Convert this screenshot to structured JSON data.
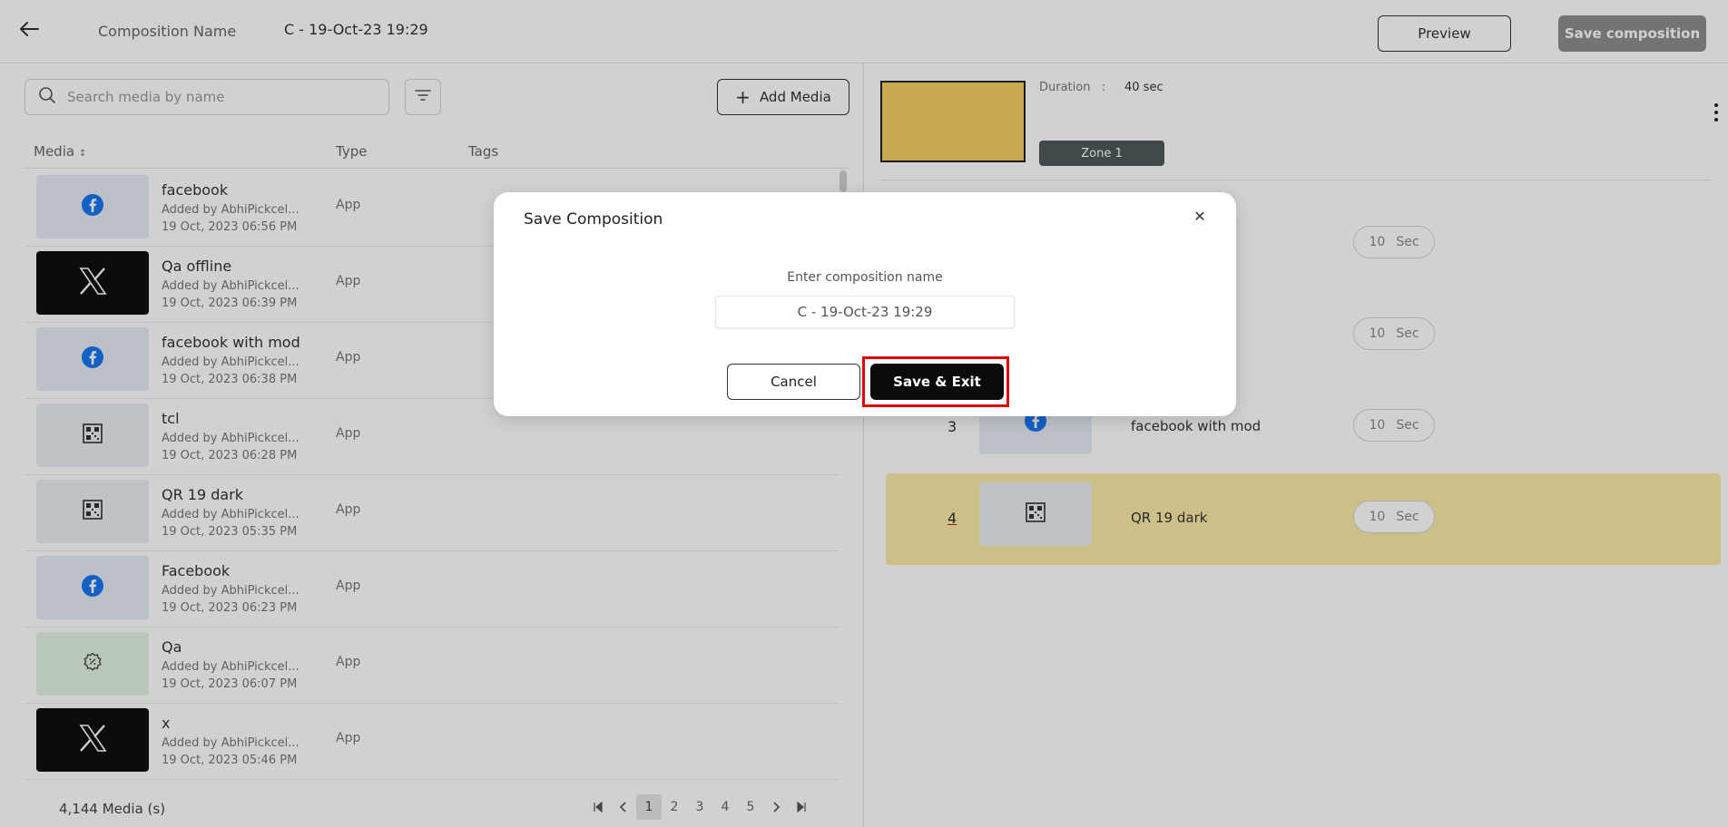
{
  "header": {
    "composition_label": "Composition Name",
    "composition_value": "C - 19-Oct-23 19:29",
    "preview_label": "Preview",
    "save_composition_label": "Save composition"
  },
  "library": {
    "search_placeholder": "Search media by name",
    "add_media_label": "Add Media",
    "columns": {
      "media": "Media",
      "type": "Type",
      "tags": "Tags"
    },
    "items": [
      {
        "name": "facebook",
        "added_by": "Added by AbhiPickcel...",
        "date": "19 Oct, 2023 06:56 PM",
        "type": "App",
        "icon": "facebook-icon"
      },
      {
        "name": "Qa offline",
        "added_by": "Added by AbhiPickcel...",
        "date": "19 Oct, 2023 06:39 PM",
        "type": "App",
        "icon": "x-logo-icon"
      },
      {
        "name": "facebook with mod",
        "added_by": "Added by AbhiPickcel...",
        "date": "19 Oct, 2023 06:38 PM",
        "type": "App",
        "icon": "facebook-icon"
      },
      {
        "name": "tcl",
        "added_by": "Added by AbhiPickcel...",
        "date": "19 Oct, 2023 06:28 PM",
        "type": "App",
        "icon": "qr-code-icon"
      },
      {
        "name": "QR 19 dark",
        "added_by": "Added by AbhiPickcel...",
        "date": "19 Oct, 2023 05:35 PM",
        "type": "App",
        "icon": "qr-code-icon"
      },
      {
        "name": "Facebook",
        "added_by": "Added by AbhiPickcel...",
        "date": "19 Oct, 2023 06:23 PM",
        "type": "App",
        "icon": "facebook-icon"
      },
      {
        "name": "Qa",
        "added_by": "Added by AbhiPickcel...",
        "date": "19 Oct, 2023 06:07 PM",
        "type": "App",
        "icon": "badge-icon"
      },
      {
        "name": "x",
        "added_by": "Added by AbhiPickcel...",
        "date": "19 Oct, 2023 05:46 PM",
        "type": "App",
        "icon": "x-logo-icon"
      }
    ],
    "count": "4,144 Media (s)",
    "pages": [
      "1",
      "2",
      "3",
      "4",
      "5"
    ],
    "current_page": "1"
  },
  "zone": {
    "duration_label": "Duration",
    "duration_separator": ":",
    "duration_value": "40 sec",
    "zone_label": "Zone 1",
    "preview_color": "#f5cd62"
  },
  "playlist": [
    {
      "index": "",
      "name": "",
      "duration": "10",
      "unit": "Sec"
    },
    {
      "index": "",
      "name": "",
      "duration": "10",
      "unit": "Sec"
    },
    {
      "index": "3",
      "name": "facebook with mod",
      "duration": "10",
      "unit": "Sec",
      "icon": "facebook-icon"
    },
    {
      "index": "4",
      "name": "QR 19 dark",
      "duration": "10",
      "unit": "Sec",
      "icon": "qr-code-icon"
    }
  ],
  "modal": {
    "title": "Save Composition",
    "prompt": "Enter composition name",
    "input_value": "C - 19-Oct-23 19:29",
    "cancel_label": "Cancel",
    "save_exit_label": "Save & Exit"
  },
  "colors": {
    "accent_dark": "#0b0b0b",
    "zone_button": "#4d5a5a",
    "active_row": "#fbe9a6",
    "highlight": "#e00000"
  }
}
